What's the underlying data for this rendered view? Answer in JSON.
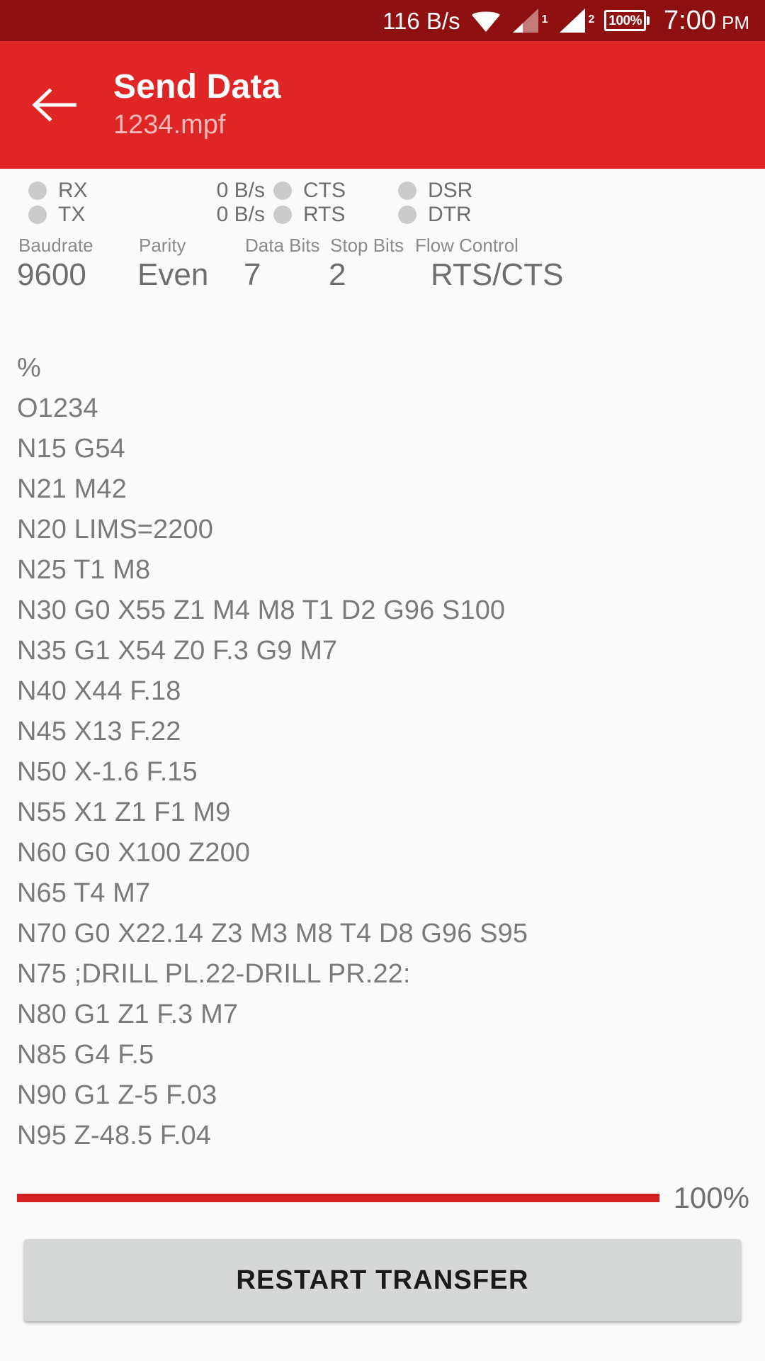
{
  "status_bar": {
    "net_speed": "116 B/s",
    "wifi_icon": "wifi-icon",
    "sim1_icon": "signal-sim1-icon",
    "sim1_label": "1",
    "sim2_icon": "signal-sim2-icon",
    "sim2_label": "2",
    "battery_icon": "battery-icon",
    "battery_percent": "100%",
    "clock_time": "7:00",
    "clock_ampm": "PM",
    "background_color": "#8E1010"
  },
  "appbar": {
    "back_icon": "arrow-back-icon",
    "title": "Send Data",
    "subtitle": "1234.mpf",
    "background_color": "#DF2525",
    "subtitle_color": "#F3B9B9"
  },
  "serial_status": {
    "leds": [
      {
        "name": "RX",
        "state": "off",
        "rate": "0 B/s"
      },
      {
        "name": "TX",
        "state": "off",
        "rate": "0 B/s"
      },
      {
        "name": "CTS",
        "state": "off"
      },
      {
        "name": "RTS",
        "state": "off"
      },
      {
        "name": "DSR",
        "state": "off"
      },
      {
        "name": "DTR",
        "state": "off"
      }
    ],
    "led_off_color": "#CBCBCB",
    "settings": [
      {
        "name": "Baudrate",
        "value": "9600"
      },
      {
        "name": "Parity",
        "value": "Even"
      },
      {
        "name": "Data Bits",
        "value": "7"
      },
      {
        "name": "Stop Bits",
        "value": "2"
      },
      {
        "name": "Flow Control",
        "value": "RTS/CTS"
      }
    ]
  },
  "log": {
    "lines": [
      "%",
      "O1234",
      "N15 G54",
      "N21 M42",
      "N20 LIMS=2200",
      "N25 T1 M8",
      "N30 G0 X55 Z1 M4 M8 T1 D2 G96 S100",
      "N35 G1 X54 Z0 F.3 G9 M7",
      "N40 X44 F.18",
      "N45 X13 F.22",
      "N50 X-1.6 F.15",
      "N55 X1 Z1 F1 M9",
      "N60 G0 X100 Z200",
      "N65 T4 M7",
      "N70 G0 X22.14 Z3 M3 M8 T4 D8 G96 S95",
      "N75 ;DRILL PL.22-DRILL PR.22:",
      "N80 G1 Z1 F.3 M7",
      "N85 G4 F.5",
      "N90 G1 Z-5 F.03",
      "N95 Z-48.5 F.04"
    ]
  },
  "progress": {
    "percent": 100,
    "label": "100%",
    "fill_color": "#D32020"
  },
  "footer": {
    "action_label": "RESTART TRANSFER"
  }
}
